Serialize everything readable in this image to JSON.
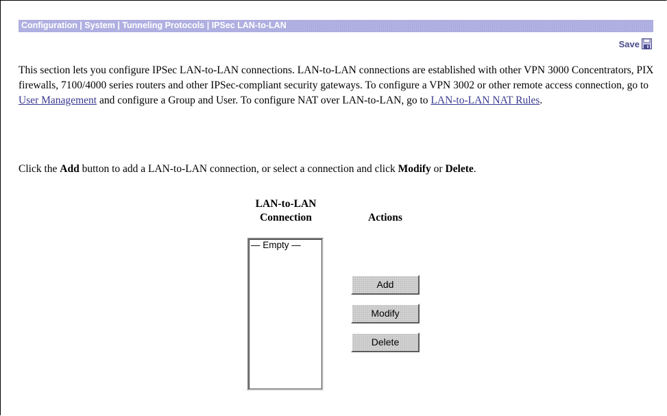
{
  "header": {
    "breadcrumb": [
      "Configuration",
      "System",
      "Tunneling Protocols",
      "IPSec LAN-to-LAN"
    ],
    "separator": " | ",
    "save_label": "Save",
    "title_bar_color": "#b4b4e4"
  },
  "intro": {
    "text_1": "This section lets you configure IPSec LAN-to-LAN connections. LAN-to-LAN connections are established with other VPN 3000 Concentrators, PIX firewalls, 7100/4000 series routers and other IPSec-compliant security gateways. To configure a VPN 3002 or other remote access connection, go to ",
    "link_user_management": "User Management",
    "text_2": " and configure a Group and User. To configure NAT over LAN-to-LAN, go to ",
    "link_nat_rules": "LAN-to-LAN NAT Rules",
    "text_3": "."
  },
  "instructions": {
    "text_1": "Click the ",
    "add_word": "Add",
    "text_2": " button to add a LAN-to-LAN connection, or select a connection and click ",
    "modify_word": "Modify",
    "text_3": " or ",
    "delete_word": "Delete",
    "text_4": "."
  },
  "table": {
    "connection_header_line1": "LAN-to-LAN",
    "connection_header_line2": "Connection",
    "actions_header": "Actions",
    "connections": [
      "— Empty —"
    ]
  },
  "actions": {
    "add_label": "Add",
    "modify_label": "Modify",
    "delete_label": "Delete"
  },
  "colors": {
    "link": "#39398f",
    "save_text": "#4a4a8c"
  },
  "icons": {
    "save": "floppy-disk-icon"
  }
}
